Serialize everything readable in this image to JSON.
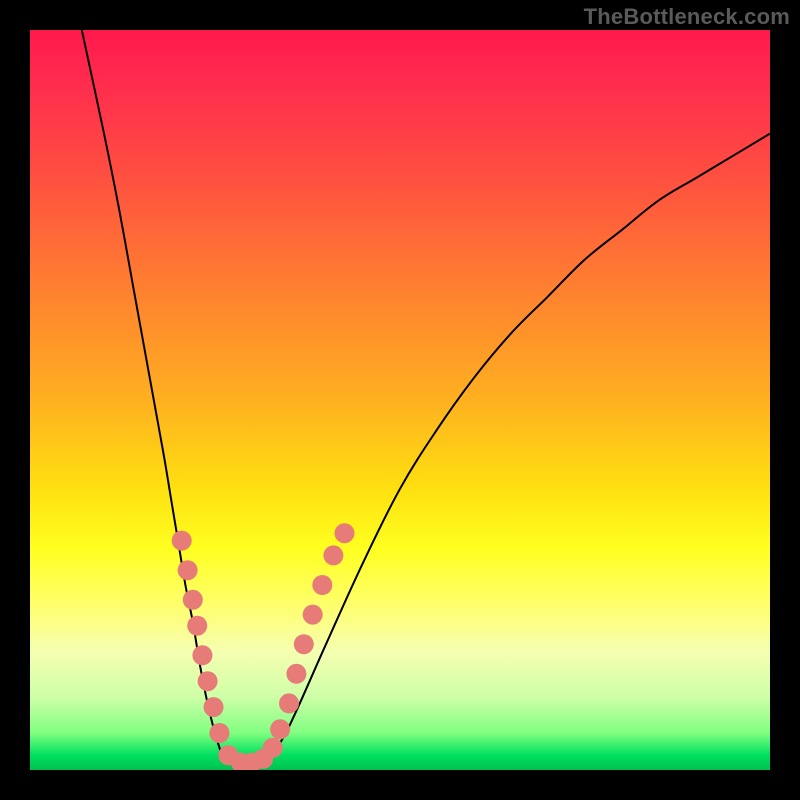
{
  "watermark": "TheBottleneck.com",
  "colors": {
    "dot": "#e77b78",
    "curve": "#000000",
    "frame": "#000000",
    "gradient_stops": [
      "#ff1a4d",
      "#ff5040",
      "#ffb020",
      "#ffff20",
      "#d0ffa8",
      "#00c050"
    ]
  },
  "chart_data": {
    "type": "line",
    "title": "",
    "xlabel": "",
    "ylabel": "",
    "xlim": [
      0,
      100
    ],
    "ylim": [
      0,
      100
    ],
    "note": "Axes unlabeled; x treated as 0–100% horizontal, y as 0–100% where 0 is bottom (green) and 100 is top (red). Values estimated from pixel positions.",
    "series": [
      {
        "name": "left-curve",
        "x": [
          7,
          10,
          12,
          14,
          16,
          18,
          19,
          20,
          21,
          22,
          23,
          24,
          25,
          26,
          27
        ],
        "y": [
          100,
          86,
          76,
          65,
          54,
          43,
          37,
          31,
          25,
          20,
          14,
          9,
          5,
          2,
          1
        ]
      },
      {
        "name": "valley-floor",
        "x": [
          27,
          28,
          29,
          30,
          31,
          32
        ],
        "y": [
          1,
          0.6,
          0.5,
          0.5,
          0.7,
          1.2
        ]
      },
      {
        "name": "right-curve",
        "x": [
          32,
          34,
          36,
          40,
          45,
          50,
          55,
          60,
          65,
          70,
          75,
          80,
          85,
          90,
          95,
          100
        ],
        "y": [
          1.2,
          4,
          8,
          17,
          28,
          38,
          46,
          53,
          59,
          64,
          69,
          73,
          77,
          80,
          83,
          86
        ]
      }
    ],
    "scatter": {
      "name": "overlay-dots",
      "note": "Approximate positions of salmon dots along the two curve arms and valley floor.",
      "points": [
        {
          "x": 20.5,
          "y": 31
        },
        {
          "x": 21.3,
          "y": 27
        },
        {
          "x": 22.0,
          "y": 23
        },
        {
          "x": 22.6,
          "y": 19.5
        },
        {
          "x": 23.3,
          "y": 15.5
        },
        {
          "x": 24.0,
          "y": 12
        },
        {
          "x": 24.8,
          "y": 8.5
        },
        {
          "x": 25.6,
          "y": 5
        },
        {
          "x": 26.8,
          "y": 2
        },
        {
          "x": 28.5,
          "y": 1
        },
        {
          "x": 30.0,
          "y": 1
        },
        {
          "x": 31.5,
          "y": 1.5
        },
        {
          "x": 32.8,
          "y": 3
        },
        {
          "x": 33.8,
          "y": 5.5
        },
        {
          "x": 35.0,
          "y": 9
        },
        {
          "x": 36.0,
          "y": 13
        },
        {
          "x": 37.0,
          "y": 17
        },
        {
          "x": 38.2,
          "y": 21
        },
        {
          "x": 39.5,
          "y": 25
        },
        {
          "x": 41.0,
          "y": 29
        },
        {
          "x": 42.5,
          "y": 32
        }
      ]
    }
  }
}
